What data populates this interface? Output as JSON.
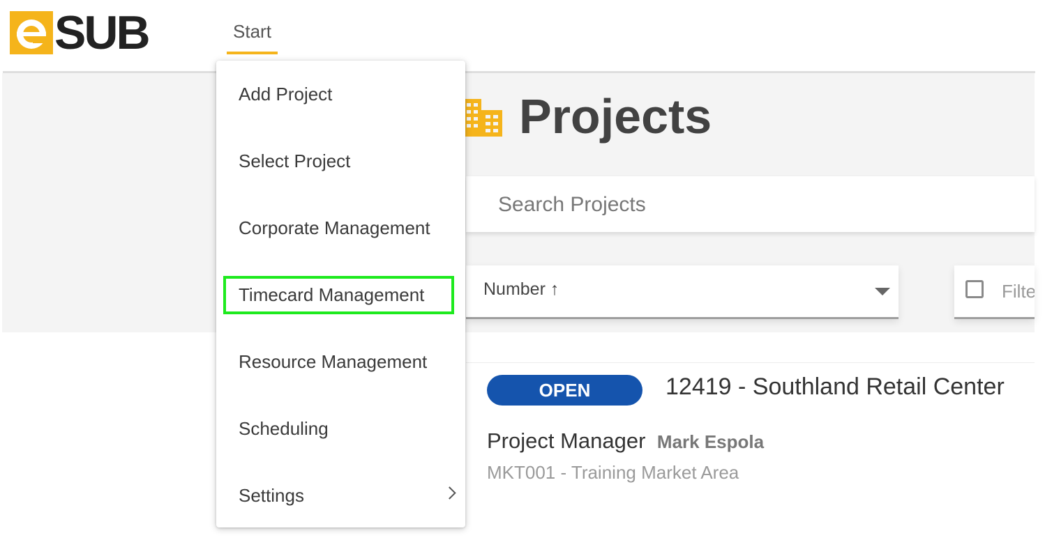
{
  "header": {
    "logo_text": "SUB",
    "nav_start_label": "Start"
  },
  "page": {
    "title": "Projects",
    "title_icon": "building-icon"
  },
  "search": {
    "placeholder": "Search Projects"
  },
  "sort": {
    "label": "Number ↑"
  },
  "filter": {
    "label": "Filte"
  },
  "project": {
    "status": "OPEN",
    "title": "12419 - Southland Retail Center",
    "pm_label": "Project Manager",
    "pm_value": "Mark Espola",
    "market_area": "MKT001 - Training Market Area"
  },
  "menu": {
    "items": [
      {
        "label": "Add Project"
      },
      {
        "label": "Select Project"
      },
      {
        "label": "Corporate Management"
      },
      {
        "label": "Timecard Management",
        "highlighted": true
      },
      {
        "label": "Resource Management"
      },
      {
        "label": "Scheduling"
      },
      {
        "label": "Settings",
        "has_submenu": true
      }
    ]
  },
  "colors": {
    "accent": "#f5b41b",
    "status_open": "#1554ad",
    "highlight": "#1eea1e"
  }
}
